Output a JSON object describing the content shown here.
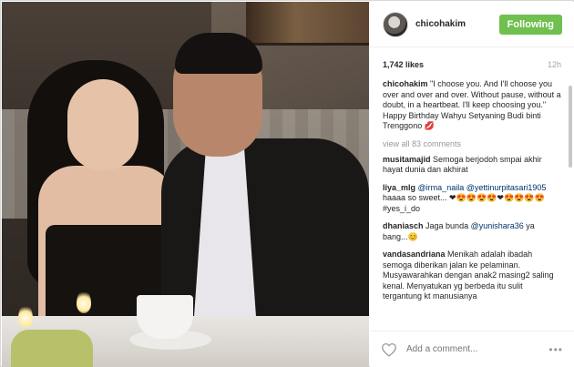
{
  "post": {
    "username": "chicohakim",
    "follow_label": "Following",
    "likes": "1,742 likes",
    "time_ago": "12h",
    "caption": {
      "user": "chicohakim",
      "text": "\"I choose you. And I'll choose you over and over and over. Without pause, without a doubt, in a heartbeat. I'll keep choosing you.\" Happy Birthday Wahyu Setyaning Budi binti Trenggono 💋"
    },
    "view_all": "view all 83 comments",
    "comments": [
      {
        "user": "musitamajid",
        "text": "Semoga berjodoh smpai akhir hayat dunia dan akhirat",
        "tag": ""
      },
      {
        "user": "liya_mlg",
        "tag": "@irma_naila @yettinurpitasari1905",
        "text": "haaaa so sweet... ❤😍😍😍😍❤😍😍😍😍 #yes_i_do"
      },
      {
        "user": "dhaniasch",
        "text": "Jaga bunda",
        "tag": "@yunishara36",
        "text2": "ya bang...😊"
      },
      {
        "user": "vandasandriana",
        "text": "Menikah adalah ibadah semoga diberikan jalan ke pelaminan. Musyawarahkan dengan anak2 masing2 saling kenal. Menyatukan yg berbeda itu sulit tergantung kt manusianya",
        "tag": ""
      }
    ],
    "add_comment_placeholder": "Add a comment...",
    "more_label": "•••"
  },
  "icons": {
    "heart": "heart-outline-icon",
    "more": "ellipsis-icon"
  },
  "colors": {
    "follow_button": "#70c050",
    "link": "#003569"
  }
}
